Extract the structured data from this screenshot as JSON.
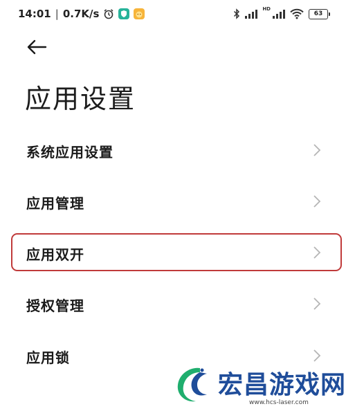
{
  "status_bar": {
    "time": "14:01",
    "separator": "|",
    "net_speed": "0.7K/s",
    "hd_label": "HD",
    "battery": "63",
    "icons": [
      "alarm-icon",
      "app-notification-icon",
      "app-notification-icon",
      "bluetooth-icon",
      "signal-icon",
      "signal-hd-icon",
      "wifi-icon",
      "battery-icon"
    ]
  },
  "header": {
    "back_icon": "back-arrow-icon",
    "title": "应用设置"
  },
  "menu": {
    "items": [
      {
        "label": "系统应用设置",
        "icon": "chevron-right-icon"
      },
      {
        "label": "应用管理",
        "icon": "chevron-right-icon"
      },
      {
        "label": "应用双开",
        "icon": "chevron-right-icon",
        "highlighted": true
      },
      {
        "label": "授权管理",
        "icon": "chevron-right-icon"
      },
      {
        "label": "应用锁",
        "icon": "chevron-right-icon"
      }
    ]
  },
  "watermark": {
    "name": "宏昌游戏网",
    "url": "www.hcs-laser.com"
  },
  "colors": {
    "highlight_border": "#c03a3a",
    "watermark_blue": "#1f4d9a",
    "watermark_green": "#1fae6e"
  }
}
